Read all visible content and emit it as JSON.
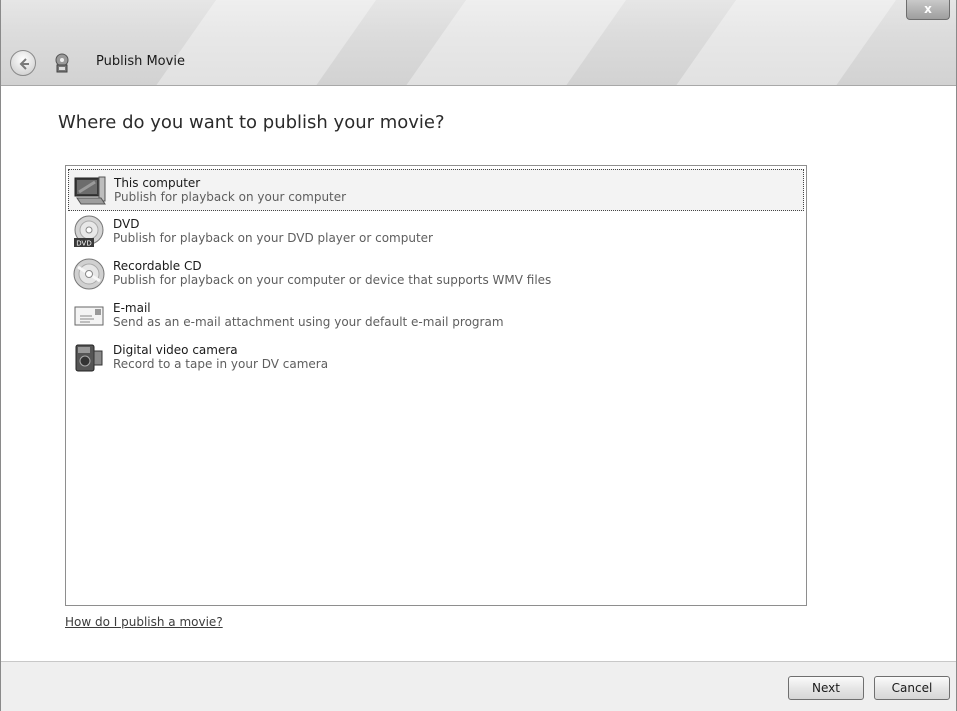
{
  "window": {
    "title": "Publish Movie",
    "close_label": "x"
  },
  "heading": "Where do you want to publish your movie?",
  "options": [
    {
      "name": "This computer",
      "desc": "Publish for playback on your computer",
      "icon": "computer-icon",
      "selected": true
    },
    {
      "name": "DVD",
      "desc": "Publish for playback on your DVD player or computer",
      "icon": "dvd-icon",
      "selected": false
    },
    {
      "name": "Recordable CD",
      "desc": "Publish for playback on your computer or device that supports WMV files",
      "icon": "cd-icon",
      "selected": false
    },
    {
      "name": "E-mail",
      "desc": "Send as an e-mail attachment using your default e-mail program",
      "icon": "email-icon",
      "selected": false
    },
    {
      "name": "Digital video camera",
      "desc": "Record to a tape in your DV camera",
      "icon": "camcorder-icon",
      "selected": false
    }
  ],
  "help_link": "How do I publish a movie?",
  "buttons": {
    "next": "Next",
    "cancel": "Cancel"
  },
  "dvd_badge": "DVD"
}
